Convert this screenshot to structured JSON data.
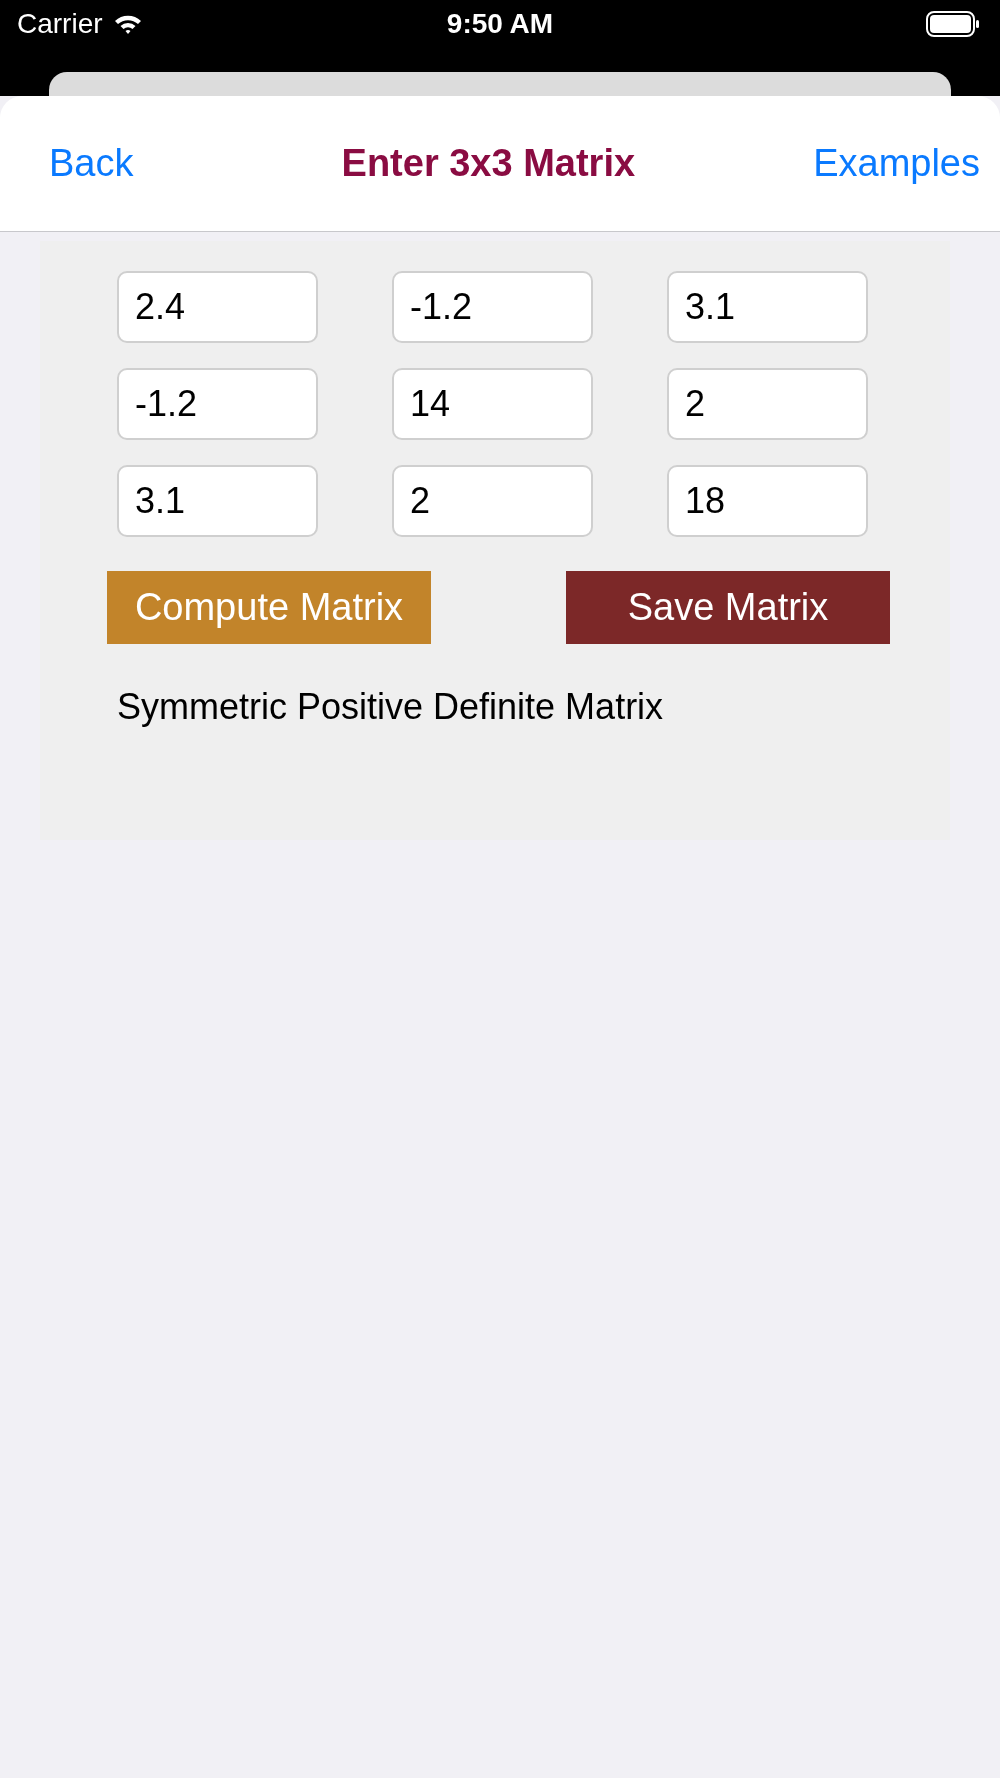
{
  "status_bar": {
    "carrier": "Carrier",
    "time": "9:50 AM"
  },
  "nav": {
    "back": "Back",
    "title": "Enter 3x3 Matrix",
    "action": "Examples"
  },
  "matrix": [
    [
      "2.4",
      "-1.2",
      "3.1"
    ],
    [
      "-1.2",
      "14",
      "2"
    ],
    [
      "3.1",
      "2",
      "18"
    ]
  ],
  "buttons": [
    {
      "label": "Compute Matrix",
      "kind": "compute"
    },
    {
      "label": "Save Matrix",
      "kind": "save"
    }
  ],
  "result": "Symmetric Positive Definite Matrix"
}
